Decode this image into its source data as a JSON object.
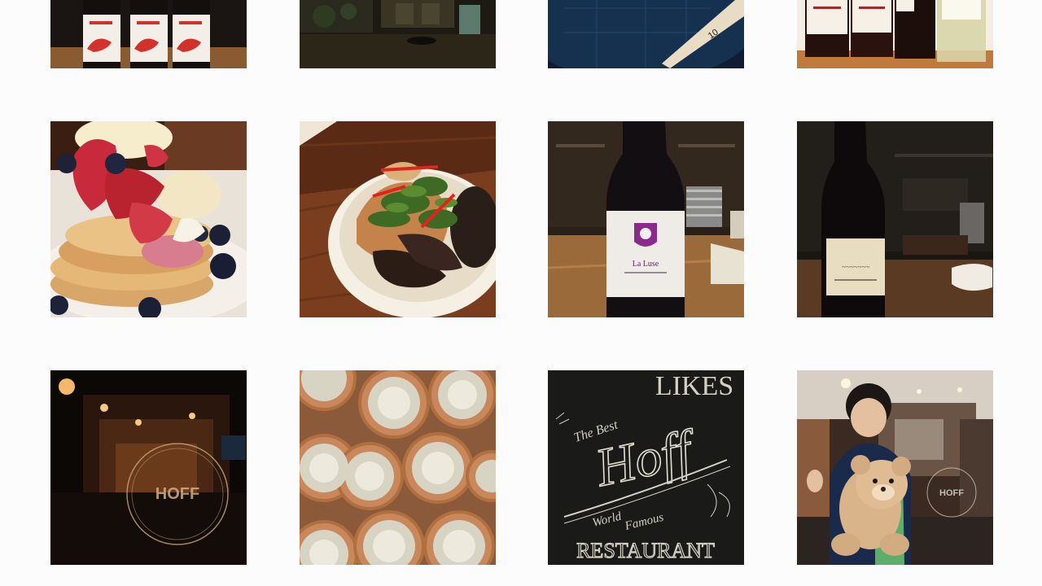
{
  "gallery": {
    "rows": [
      {
        "tiles": [
          {
            "name": "red-label-wine-bottles",
            "interactable": true
          },
          {
            "name": "rainy-storefront-night",
            "interactable": true
          },
          {
            "name": "blue-barrel-clock",
            "interactable": true
          },
          {
            "name": "wine-bottle-lineup",
            "interactable": true
          }
        ]
      },
      {
        "tiles": [
          {
            "name": "berry-pancake-stack",
            "interactable": true
          },
          {
            "name": "mussel-salad-plate",
            "interactable": true
          },
          {
            "name": "la-luse-wine-bottle",
            "interactable": true,
            "label_text": "La Luse"
          },
          {
            "name": "dark-wine-bottle-bar",
            "interactable": true
          }
        ]
      },
      {
        "tiles": [
          {
            "name": "hoff-restaurant-window",
            "interactable": true,
            "logo_text": "HOFF"
          },
          {
            "name": "glass-jars-grid",
            "interactable": true
          },
          {
            "name": "chalkboard-hoff-sign",
            "interactable": true,
            "text": {
              "top": "LIKES",
              "best": "The Best",
              "name": "Hoff",
              "world": "World",
              "famous": "Famous",
              "bottom": "RESTAURANT"
            }
          },
          {
            "name": "boy-with-teddy-bear",
            "interactable": true,
            "logo_text": "HOFF"
          }
        ]
      }
    ]
  }
}
